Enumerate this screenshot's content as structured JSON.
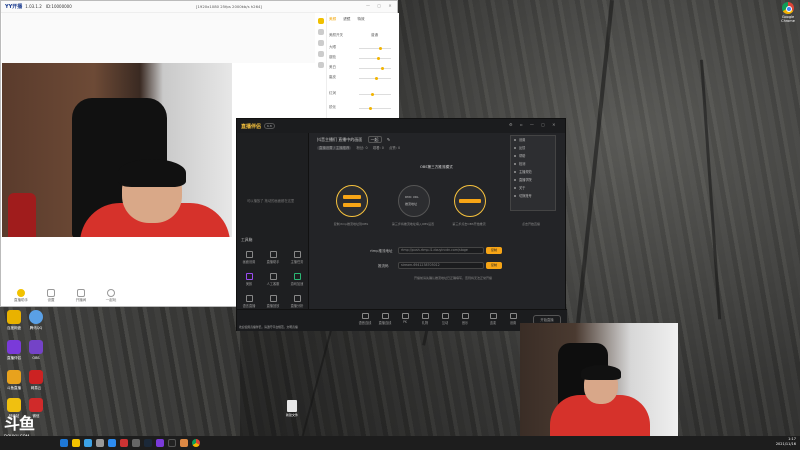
{
  "desktop": {
    "icons": [
      {
        "label": "百度网盘"
      },
      {
        "label": "腾讯QQ"
      },
      {
        "label": "直播伴侣"
      },
      {
        "label": "OBS"
      },
      {
        "label": "斗鱼直播"
      },
      {
        "label": "网易云"
      },
      {
        "label": "回收站"
      },
      {
        "label": "微信"
      }
    ],
    "file_label": "新建文件"
  },
  "chrome": {
    "label": "Google Chrome"
  },
  "watermark": {
    "brand": "斗鱼",
    "url": "DOUYU.COM"
  },
  "yy": {
    "logo": "YY开播",
    "version": "1.03.1.2",
    "id": "ID:10000000",
    "resolution": "[1920x1080 25fps 2000kb/s h264]",
    "panel_tabs": [
      "美颜",
      "滤镜",
      "特效"
    ],
    "side_items": [
      "美颜",
      "滤镜",
      "贴纸",
      "背景",
      "虚拟"
    ],
    "rows": [
      {
        "label": "美颜开关",
        "value": "普通"
      },
      {
        "label": "大眼"
      },
      {
        "label": "瘦脸"
      },
      {
        "label": "美白"
      },
      {
        "label": "磨皮"
      },
      {
        "label": "红润"
      },
      {
        "label": "锐化"
      }
    ],
    "bottom_buttons": [
      "直播助手",
      "设置",
      "开播间",
      "一起玩"
    ]
  },
  "zb": {
    "logo": "直播伴侣",
    "version": "6.8",
    "room_title": "抖音主播们 直播中的画面",
    "room_tag": "一起",
    "category": "直播设置 / 主播推荐",
    "stats": [
      "粉丝: 0",
      "观看: 0",
      "点赞: 0"
    ],
    "left_hint": "可以播放了 拖动的画面都在这里",
    "tools_label": "工具箱",
    "tools": [
      "画面设置",
      "直播助手",
      "主播任务",
      "美颜",
      "人工客服",
      "游戏加速",
      "语言直播",
      "直播回放",
      "直播分析"
    ],
    "mode_title": "OBS第三方推流模式",
    "circles": [
      {
        "label": "第一步",
        "btns": [
          "推流",
          "推流"
        ]
      },
      {
        "label": "RMC URL",
        "sub": "推流地址"
      },
      {
        "label": "直播",
        "btns": [
          "开始直播"
        ]
      }
    ],
    "captions": [
      "复制rtmp推流地址到OBS",
      "第三步将推流地址填入OBS设置",
      "第三步点击OBS开始推流",
      "点击开始直播"
    ],
    "fields": [
      {
        "label": "rtmp推流地址",
        "value": "rtmp://push-rtmp-l1.douyincdn.com/stage",
        "btn": "复制"
      },
      {
        "label": "推流码",
        "value": "stream-6941238705012",
        "btn": "复制"
      }
    ],
    "footnote": "开播前请先确认推流地址已正确填写，否则将无法正常开播",
    "footer": [
      "语音连线",
      "直播连线",
      "PK",
      "礼物",
      "互动",
      "音乐",
      "连麦",
      "设置"
    ],
    "start_button": "开始直播",
    "notice": "欢迎使用直播伴侣，请遵守平台规范，文明直播",
    "menu": [
      "设置",
      "反馈",
      "帮助",
      "检测",
      "主播规范",
      "直播学院",
      "关于",
      "切换账号"
    ]
  },
  "tray": {
    "time": "1:17",
    "date": "2021/11/16"
  }
}
